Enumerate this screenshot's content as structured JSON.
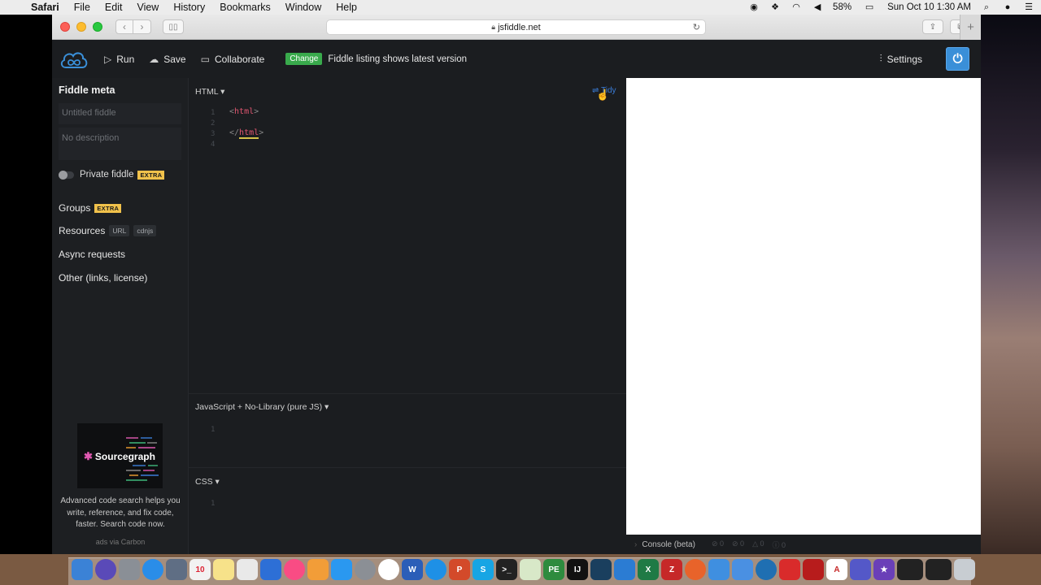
{
  "menubar": {
    "app_name": "Safari",
    "items": [
      "File",
      "Edit",
      "View",
      "History",
      "Bookmarks",
      "Window",
      "Help"
    ],
    "battery": "58%",
    "datetime": "Sun Oct 10  1:30 AM"
  },
  "browser": {
    "url": "jsfiddle.net"
  },
  "header": {
    "run_label": "Run",
    "save_label": "Save",
    "collaborate_label": "Collaborate",
    "change_badge": "Change",
    "listing_note": "Fiddle listing shows latest version",
    "settings_label": "Settings"
  },
  "sidebar": {
    "title": "Fiddle meta",
    "title_placeholder": "Untitled fiddle",
    "description_placeholder": "No description",
    "private_label": "Private fiddle",
    "extra_badge": "EXTRA",
    "groups_label": "Groups",
    "resources_label": "Resources",
    "resources_url": "URL",
    "resources_cdnjs": "cdnjs",
    "async_label": "Async requests",
    "other_label": "Other (links, license)",
    "ad_brand": "Sourcegraph",
    "ad_text": "Advanced code search helps you write, reference, and fix code, faster. Search code now.",
    "ad_via": "ads via Carbon"
  },
  "editors": {
    "html_label": "HTML",
    "tidy_label": "Tidy",
    "html_lines": [
      "1",
      "2",
      "3",
      "4"
    ],
    "html_open_tag": "html",
    "html_close_tag": "html",
    "js_label": "JavaScript + No-Library (pure JS)",
    "js_lines": [
      "1"
    ],
    "css_label": "CSS",
    "css_lines": [
      "1"
    ]
  },
  "console": {
    "label": "Console (beta)",
    "counts": [
      "0",
      "0",
      "0",
      "0"
    ]
  },
  "colors": {
    "accent": "#3a8fd8",
    "change_green": "#39aa4c",
    "extra_yellow": "#f0c14b",
    "tag_red": "#e05670"
  }
}
